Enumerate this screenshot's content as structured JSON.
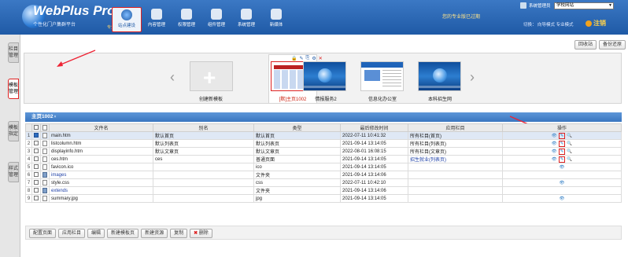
{
  "header": {
    "logo_title": "WebPlus Pro",
    "logo_subtitle": "个性化门户集群平台",
    "logo_edition": "专业版",
    "nav": [
      {
        "label": "站点建设",
        "icon": "globe-icon",
        "active": true
      },
      {
        "label": "内容管理",
        "icon": "document-icon",
        "active": false
      },
      {
        "label": "权限管理",
        "icon": "lock-icon",
        "active": false
      },
      {
        "label": "组件管理",
        "icon": "puzzle-icon",
        "active": false
      },
      {
        "label": "系统管理",
        "icon": "tools-icon",
        "active": false
      },
      {
        "label": "新媒体",
        "icon": "media-icon",
        "active": false
      }
    ],
    "warning": "您的专业版已过期",
    "user_label": "系统管理员",
    "site_select": "学校网站",
    "mode_links": "切换：  向导模式  专业模式",
    "logout": "注销"
  },
  "sidebar": {
    "tabs": [
      {
        "label": "栏目管理",
        "active": false
      },
      {
        "label": "模板管理",
        "active": true
      },
      {
        "label": "模板指定",
        "active": false
      },
      {
        "label": "样式管理",
        "active": false
      }
    ]
  },
  "toolbar": {
    "recycle": "回收站",
    "backup": "备份还原"
  },
  "templates": [
    {
      "label": "创建新模板",
      "kind": "create"
    },
    {
      "label": "[默]主页1002",
      "kind": "selected"
    },
    {
      "label": "情报服务2",
      "kind": "blue"
    },
    {
      "label": "信息化办公室",
      "kind": "cms"
    },
    {
      "label": "本科招生网",
      "kind": "blue"
    }
  ],
  "grid": {
    "title": "主页1002",
    "close": "×",
    "columns": [
      "文件名",
      "别名",
      "类型",
      "最后修改时间",
      "应用栏目",
      "操作"
    ],
    "rows": [
      {
        "num": "1",
        "checked": true,
        "name": "main.htm",
        "alias": "默认首页",
        "type": "默认首页",
        "time": "2022-07-11 10:41:32",
        "app": "所有栏目(首页)",
        "folder": false,
        "ops": "view-edit-find"
      },
      {
        "num": "2",
        "checked": false,
        "name": "listcolumn.htm",
        "alias": "默认列表页",
        "type": "默认列表页",
        "time": "2021-09-14 13:14:05",
        "app": "所有栏目(列表页)",
        "folder": false,
        "ops": "view-edit-find"
      },
      {
        "num": "3",
        "checked": false,
        "name": "displayinfo.htm",
        "alias": "默认文章页",
        "type": "默认文章页",
        "time": "2022-08-01 16:08:15",
        "app": "所有栏目(文章页)",
        "folder": false,
        "ops": "view-edit-find"
      },
      {
        "num": "4",
        "checked": false,
        "name": "ces.htm",
        "alias": "ces",
        "type": "普通页面",
        "time": "2021-09-14 13:14:05",
        "app": "招生就业(列表页)",
        "folder": false,
        "ops": "view-edit-find"
      },
      {
        "num": "5",
        "checked": false,
        "name": "favicon.ico",
        "alias": "",
        "type": "ico",
        "time": "2021-09-14 13:14:05",
        "app": "",
        "folder": false,
        "ops": "view"
      },
      {
        "num": "6",
        "checked": false,
        "name": "images",
        "alias": "",
        "type": "文件夹",
        "time": "2021-09-14 13:14:06",
        "app": "",
        "folder": true,
        "ops": ""
      },
      {
        "num": "7",
        "checked": false,
        "name": "style.css",
        "alias": "",
        "type": "css",
        "time": "2022-07-11 10:42:10",
        "app": "",
        "folder": false,
        "ops": "view"
      },
      {
        "num": "8",
        "checked": false,
        "name": "extends",
        "alias": "",
        "type": "文件夹",
        "time": "2021-09-14 13:14:06",
        "app": "",
        "folder": true,
        "ops": ""
      },
      {
        "num": "9",
        "checked": false,
        "name": "summary.jpg",
        "alias": "",
        "type": "jpg",
        "time": "2021-09-14 13:14:05",
        "app": "",
        "folder": false,
        "ops": "view"
      }
    ]
  },
  "bottom_buttons": [
    "配置页面",
    "应用栏目",
    "编辑",
    "新建模板页",
    "新建资源",
    "复制",
    "删除"
  ],
  "colors": {
    "header_blue": "#1f5aa6",
    "accent_red": "#dd2222"
  }
}
